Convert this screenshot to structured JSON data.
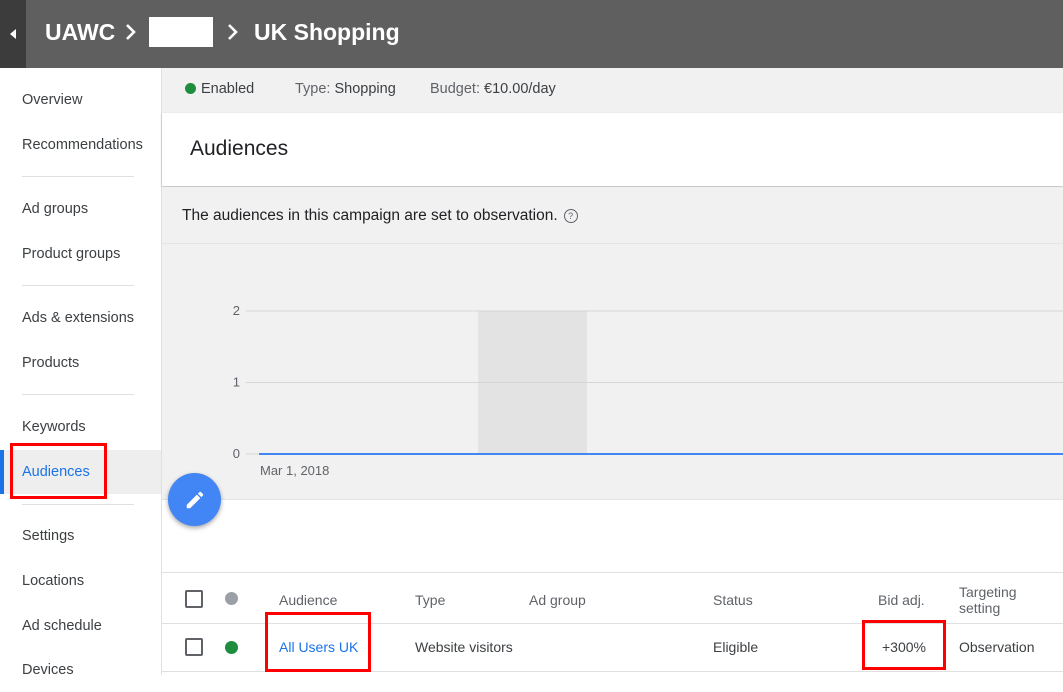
{
  "header": {
    "crumbs": [
      "UAWC",
      "UK Shopping"
    ]
  },
  "sidebar": {
    "items": [
      {
        "label": "Overview"
      },
      {
        "label": "Recommendations"
      },
      {
        "label": "Ad groups"
      },
      {
        "label": "Product groups"
      },
      {
        "label": "Ads & extensions"
      },
      {
        "label": "Products"
      },
      {
        "label": "Keywords"
      },
      {
        "label": "Audiences"
      },
      {
        "label": "Settings"
      },
      {
        "label": "Locations"
      },
      {
        "label": "Ad schedule"
      },
      {
        "label": "Devices"
      }
    ],
    "active": "Audiences"
  },
  "status": {
    "state": "Enabled",
    "type_label": "Type:",
    "type_value": "Shopping",
    "budget_label": "Budget:",
    "budget_value": "€10.00/day"
  },
  "colors": {
    "enabled": "#1e8e3e",
    "accent": "#1a73e8",
    "highlight": "#ff0000"
  },
  "section_title": "Audiences",
  "observation_message": "The audiences in this campaign are set to observation.",
  "chart_data": {
    "type": "line",
    "x": [
      "Mar 1, 2018"
    ],
    "series": [
      {
        "values": [
          0
        ]
      }
    ],
    "yticks": [
      "0",
      "1",
      "2"
    ],
    "ylim": [
      0,
      2
    ],
    "grid": true
  },
  "table": {
    "headers": {
      "audience": "Audience",
      "type": "Type",
      "ad_group": "Ad group",
      "status": "Status",
      "bid_adj": "Bid adj.",
      "targeting_line1": "Targeting",
      "targeting_line2": "setting"
    },
    "rows": [
      {
        "audience": "All Users UK",
        "type": "Website visitors",
        "ad_group": "",
        "status": "Eligible",
        "bid_adj": "+300%",
        "targeting": "Observation"
      }
    ]
  },
  "icons": [
    "back-arrow-icon",
    "chevron-right-icon",
    "help-icon",
    "pencil-icon",
    "status-dot-icon"
  ]
}
